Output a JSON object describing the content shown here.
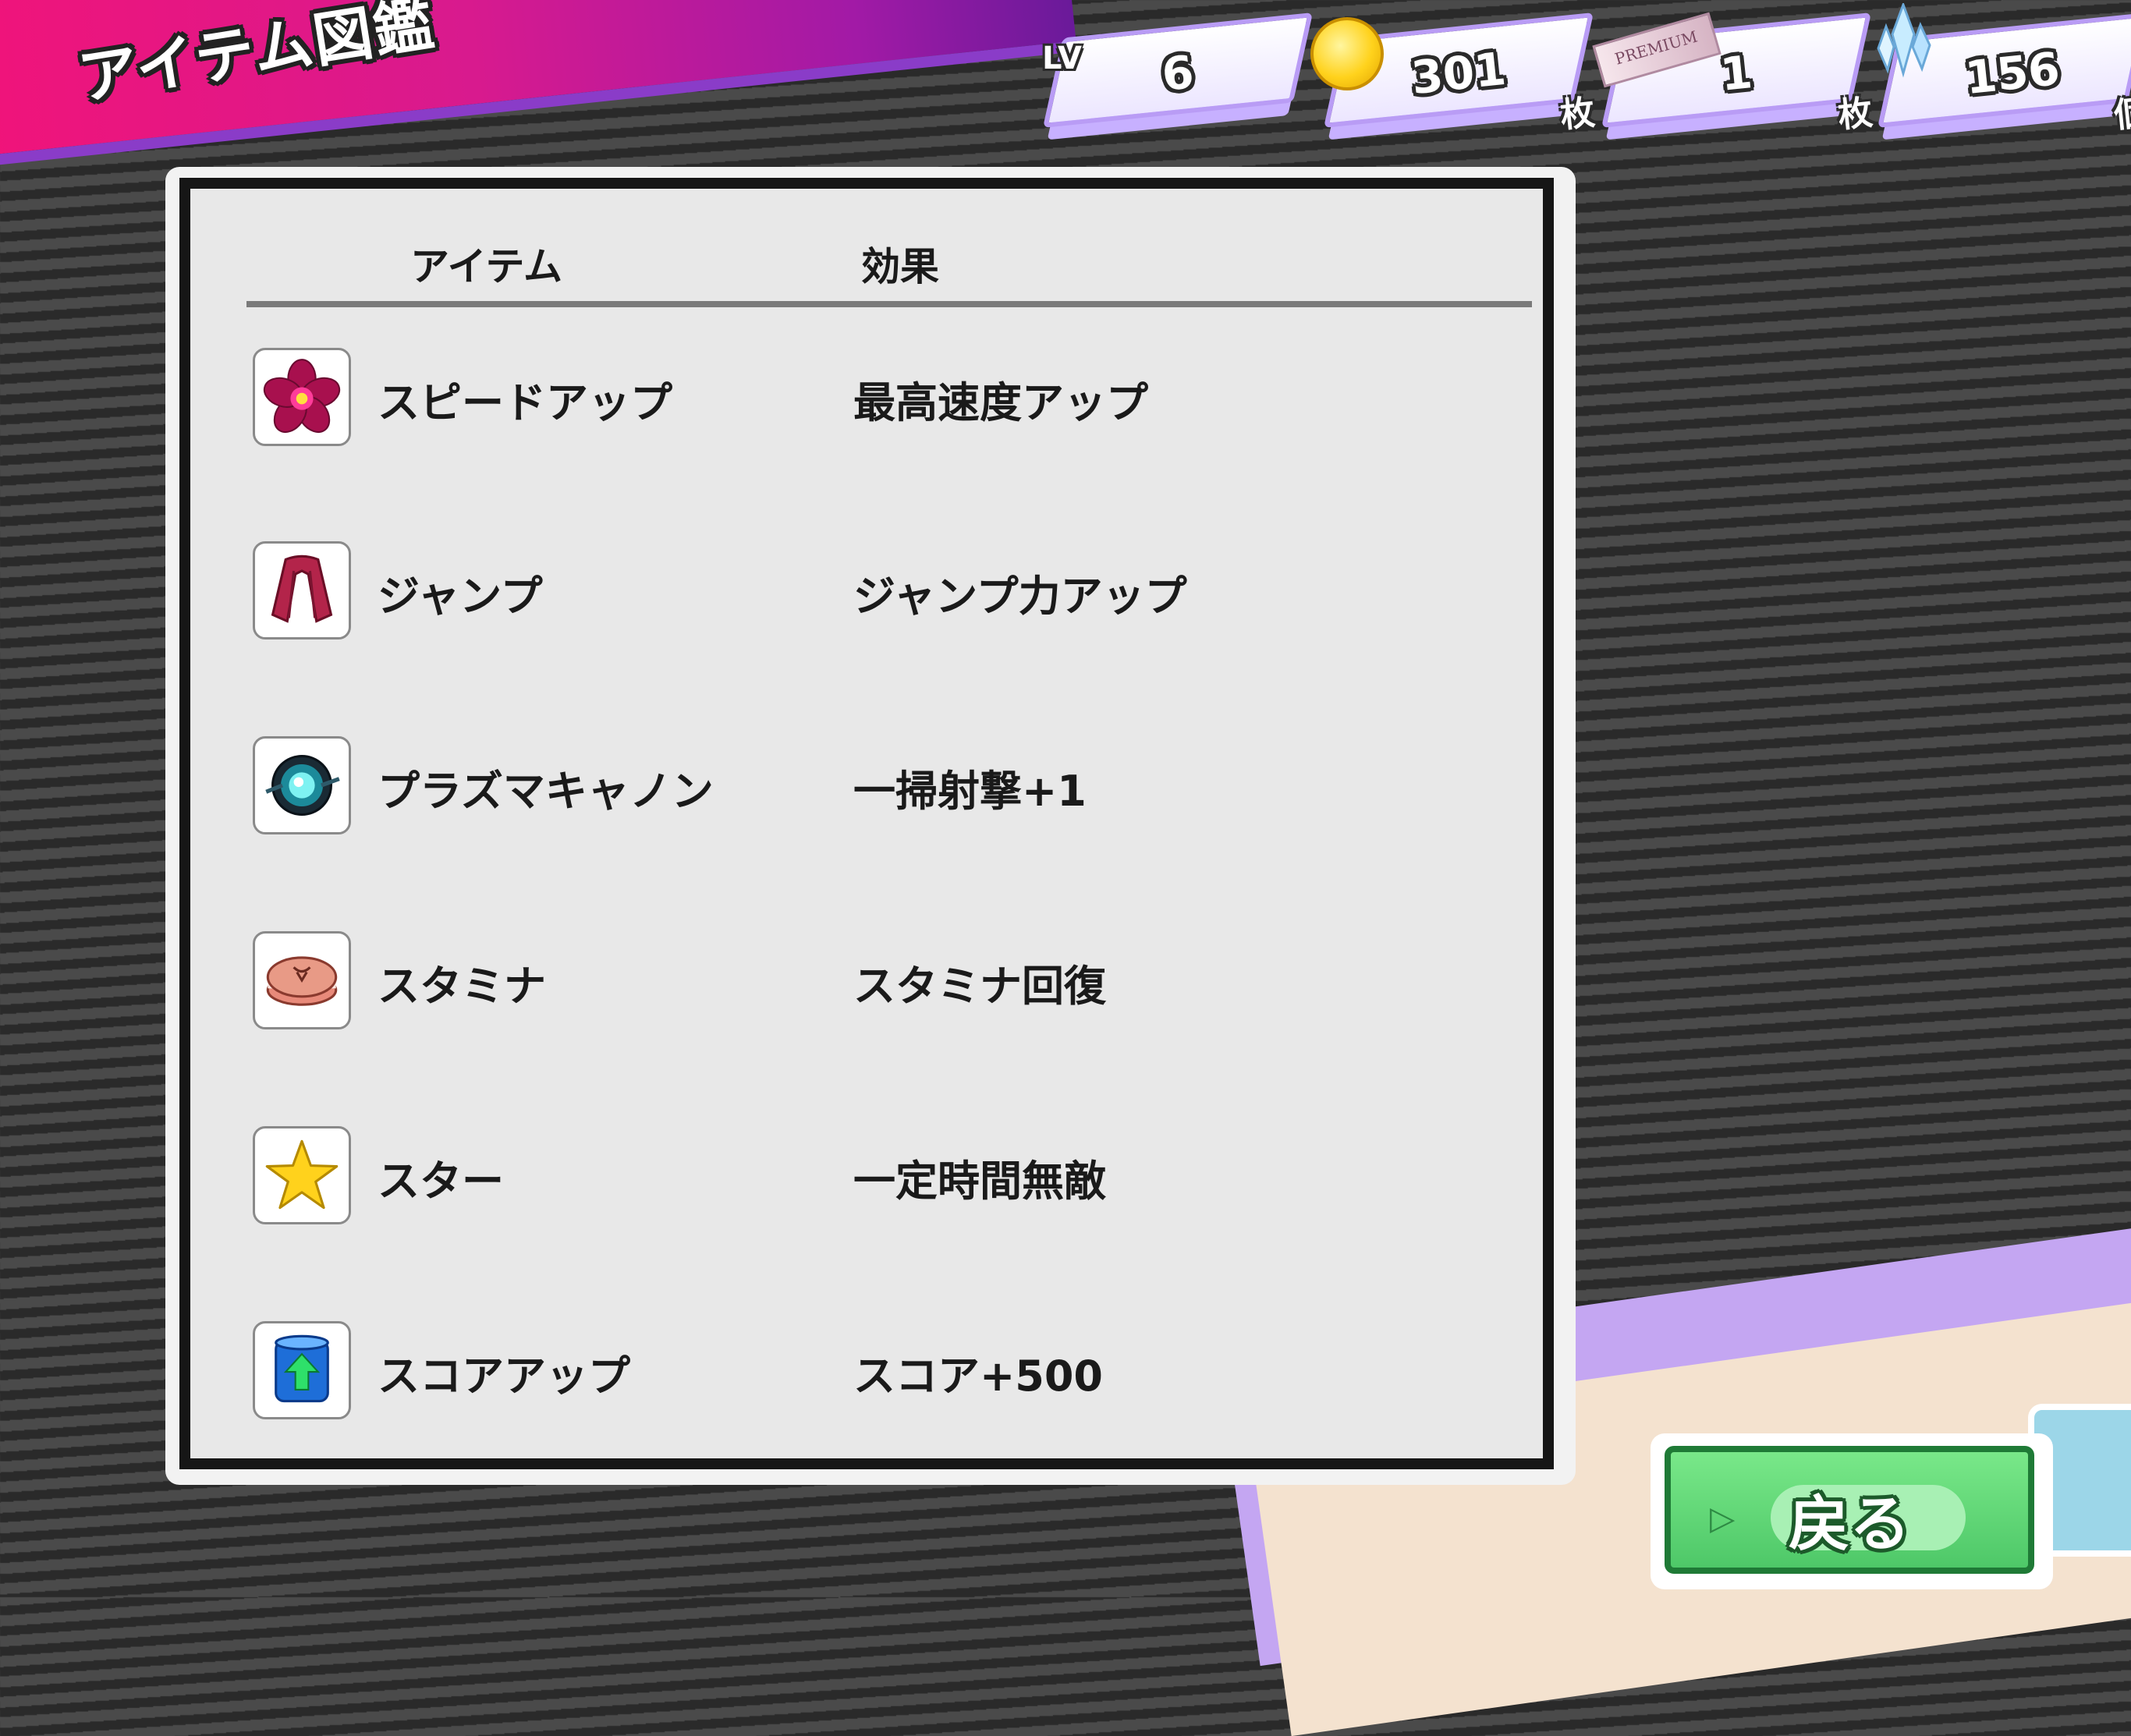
{
  "header": {
    "title": "アイテム図鑑"
  },
  "stats": {
    "level_label": "LV",
    "level": "6",
    "coins": "301",
    "coins_unit": "枚",
    "premium_label": "PREMIUM",
    "tickets": "1",
    "tickets_unit": "枚",
    "crystals": "156",
    "crystals_unit": "個"
  },
  "table": {
    "col_item": "アイテム",
    "col_effect": "効果",
    "rows": [
      {
        "name": "スピードアップ",
        "effect": "最高速度アップ",
        "icon": "flower-icon"
      },
      {
        "name": "ジャンプ",
        "effect": "ジャンプ力アップ",
        "icon": "scarf-icon"
      },
      {
        "name": "プラズマキャノン",
        "effect": "一掃射撃+1",
        "icon": "plasma-orb-icon"
      },
      {
        "name": "スタミナ",
        "effect": "スタミナ回復",
        "icon": "macaron-icon"
      },
      {
        "name": "スター",
        "effect": "一定時間無敵",
        "icon": "star-icon"
      },
      {
        "name": "スコアアップ",
        "effect": "スコア+500",
        "icon": "score-can-icon"
      }
    ]
  },
  "footer": {
    "back_label": "戻る"
  },
  "colors": {
    "banner": "#f0147a",
    "accent_purple": "#c7b0ff",
    "back_green": "#4ec868"
  }
}
